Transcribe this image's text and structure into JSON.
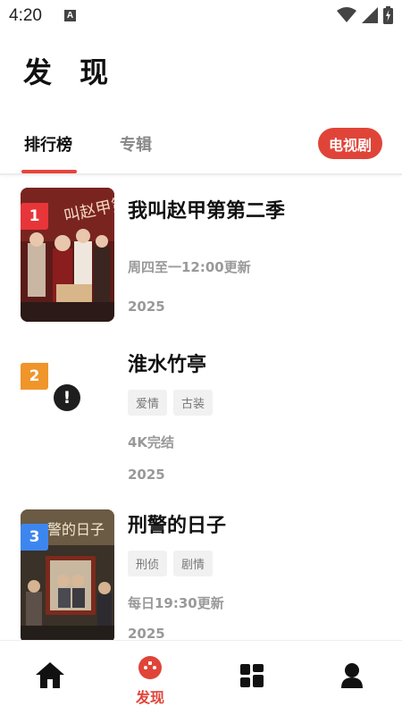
{
  "status_bar": {
    "time": "4:20",
    "notification_letter": "A"
  },
  "page": {
    "title": "发 现"
  },
  "tabs": {
    "items": [
      {
        "label": "排行榜",
        "active": true
      },
      {
        "label": "专辑",
        "active": false
      }
    ],
    "type_chip": "电视剧"
  },
  "list": [
    {
      "rank": "1",
      "rank_color": "#e8353a",
      "title": "我叫赵甲第第二季",
      "tags": [],
      "update": "周四至一12:00更新",
      "year": "2025",
      "poster_state": "image"
    },
    {
      "rank": "2",
      "rank_color": "#f0952a",
      "title": "淮水竹亭",
      "tags": [
        "爱情",
        "古装"
      ],
      "update": "4K完结",
      "year": "2025",
      "poster_state": "error"
    },
    {
      "rank": "3",
      "rank_color": "#3d86f0",
      "title": "刑警的日子",
      "tags": [
        "刑侦",
        "剧情"
      ],
      "update": "每日19:30更新",
      "year": "2025",
      "poster_state": "image"
    }
  ],
  "bottom_nav": {
    "items": [
      {
        "icon": "home-icon",
        "label": ""
      },
      {
        "icon": "discover-icon",
        "label": "发现",
        "active": true
      },
      {
        "icon": "grid-icon",
        "label": ""
      },
      {
        "icon": "profile-icon",
        "label": ""
      }
    ]
  },
  "colors": {
    "accent": "#e04438",
    "rank1": "#e8353a",
    "rank2": "#f0952a",
    "rank3": "#3d86f0"
  }
}
